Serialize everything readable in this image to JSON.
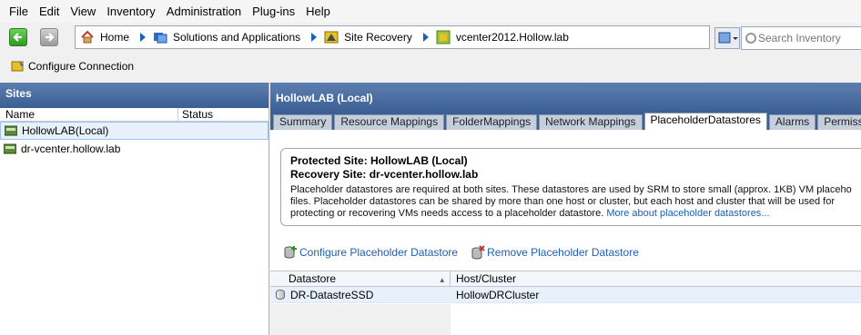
{
  "menu": [
    "File",
    "Edit",
    "View",
    "Inventory",
    "Administration",
    "Plug-ins",
    "Help"
  ],
  "breadcrumb": [
    {
      "label": "Home",
      "icon": "home-icon"
    },
    {
      "label": "Solutions and Applications",
      "icon": "solutions-icon"
    },
    {
      "label": "Site Recovery",
      "icon": "site-recovery-icon"
    },
    {
      "label": "vcenter2012.Hollow.lab",
      "icon": "vcenter-icon"
    }
  ],
  "search": {
    "placeholder": "Search Inventory"
  },
  "toolbar": {
    "configure_connection": "Configure Connection"
  },
  "sites_panel": {
    "title": "Sites",
    "columns": [
      "Name",
      "Status"
    ],
    "items": [
      {
        "name": "HollowLAB(Local)",
        "status": ""
      },
      {
        "name": "dr-vcenter.hollow.lab",
        "status": ""
      }
    ]
  },
  "main": {
    "title": "HollowLAB (Local)",
    "tabs": [
      "Summary",
      "Resource Mappings",
      "FolderMappings",
      "Network Mappings",
      "PlaceholderDatastores",
      "Alarms",
      "Permissions"
    ],
    "active_tab": "PlaceholderDatastores",
    "protected_site": "Protected Site: HollowLAB (Local)",
    "recovery_site": "Recovery Site: dr-vcenter.hollow.lab",
    "desc_line1": "Placeholder datastores are required at both sites. These datastores are used by SRM to store small (approx. 1KB) VM placeho",
    "desc_line2": "files. Placeholder datastores can be shared by more than one host or cluster, but each host and cluster that will be used for",
    "desc_line3": "protecting or recovering VMs needs access to a placeholder datastore.",
    "more_link": "More about placeholder datastores...",
    "configure_action": "Configure Placeholder Datastore",
    "remove_action": "Remove Placeholder Datastore",
    "grid": {
      "columns": [
        "Datastore",
        "Host/Cluster"
      ],
      "rows": [
        {
          "datastore": "DR-DatastreSSD",
          "host": "HollowDRCluster"
        }
      ]
    }
  }
}
